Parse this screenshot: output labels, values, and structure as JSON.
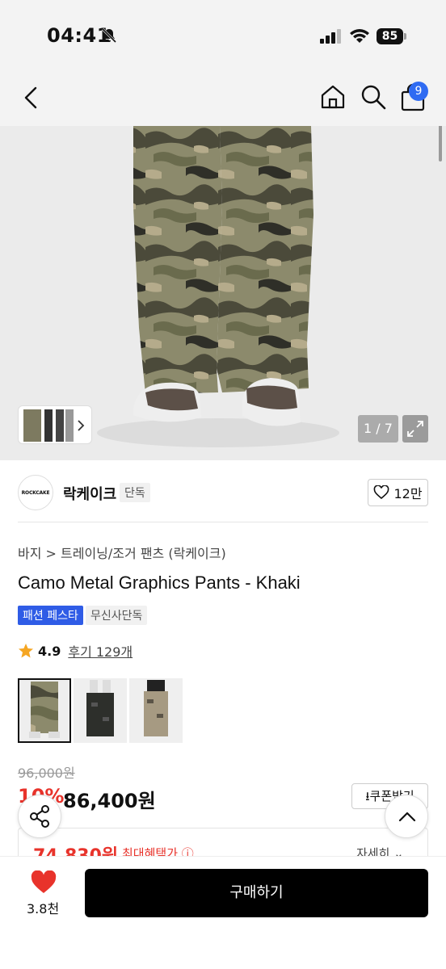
{
  "status_bar": {
    "time": "04:41",
    "battery": "85"
  },
  "nav": {
    "cart_count": "9"
  },
  "gallery": {
    "counter": "1 / 7"
  },
  "brand": {
    "logo_text": "ROCKCAKE",
    "name": "락케이크",
    "tag": "단독",
    "likes": "12만"
  },
  "breadcrumb": "바지 > 트레이닝/조거 팬츠 (락케이크)",
  "product": {
    "title": "Camo Metal Graphics Pants - Khaki",
    "badges": [
      "패션 페스타",
      "무신사단독"
    ],
    "rating": "4.9",
    "reviews": "후기 129개",
    "original_price": "96,000원",
    "discount": "10%",
    "price": "86,400원",
    "coupon_label": "쿠폰받기",
    "benefit_price": "74,830원",
    "benefit_label": "최대혜택가",
    "benefit_detail": "자세히"
  },
  "options": [
    "khaki-camo",
    "black-camo",
    "beige-camo"
  ],
  "bottom_bar": {
    "heart_count": "3.8천",
    "buy_label": "구매하기"
  },
  "colors": {
    "accent_red": "#e8332b",
    "badge_blue": "#2f5ce6",
    "cart_badge": "#2f6bf2"
  }
}
